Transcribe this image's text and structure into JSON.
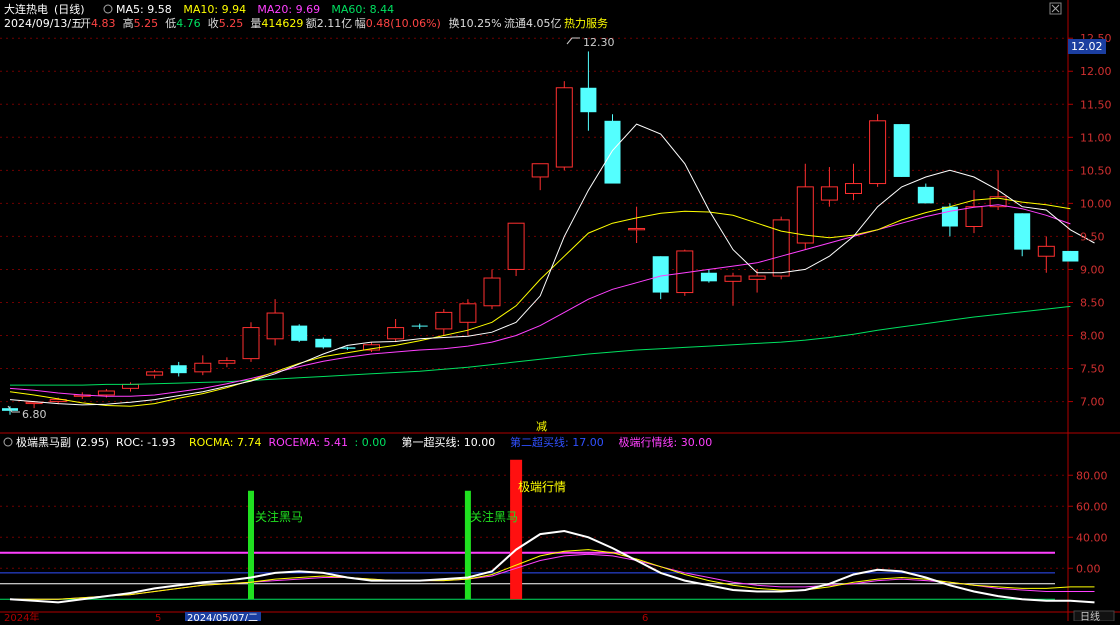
{
  "header": {
    "stock_name": "大连热电",
    "period_label": "(日线)",
    "date": "2024/09/13/五",
    "items": [
      {
        "label": "开",
        "value": "4.83",
        "color": "#ff4444"
      },
      {
        "label": "高",
        "value": "5.25",
        "color": "#ff4444"
      },
      {
        "label": "低",
        "value": "4.76",
        "color": "#00e060"
      },
      {
        "label": "收",
        "value": "5.25",
        "color": "#ff4444"
      },
      {
        "label": "量",
        "value": "414629",
        "color": "#ffff00"
      },
      {
        "label": "额",
        "value": "2.11亿",
        "color": "#dddddd"
      },
      {
        "label": "幅",
        "value": "0.48(10.06%)",
        "color": "#ff4444"
      },
      {
        "label": "换",
        "value": "10.25%",
        "color": "#dddddd"
      },
      {
        "label": "流通",
        "value": "4.05亿",
        "color": "#dddddd"
      },
      {
        "label": "",
        "value": "热力服务",
        "color": "#ffff00"
      }
    ],
    "ma_legend": [
      {
        "label": "MA5: 9.58",
        "color": "#ffffff"
      },
      {
        "label": "MA10: 9.94",
        "color": "#ffff00"
      },
      {
        "label": "MA20: 9.69",
        "color": "#ff40ff"
      },
      {
        "label": "MA60: 8.44",
        "color": "#00e060"
      }
    ]
  },
  "sub_header": {
    "name": "极端黑马副",
    "param": "(2.95)",
    "items": [
      {
        "label": "ROC: -1.93",
        "color": "#ffffff"
      },
      {
        "label": "ROCMA: 7.74",
        "color": "#ffff00"
      },
      {
        "label": "ROCEMA: 5.41",
        "color": "#ff40ff"
      },
      {
        "label": ": 0.00",
        "color": "#00e060"
      },
      {
        "label": "第一超买线: 10.00",
        "color": "#ffffff"
      },
      {
        "label": "第二超买线: 17.00",
        "color": "#3050ff"
      },
      {
        "label": "极端行情线: 30.00",
        "color": "#ff40ff"
      }
    ]
  },
  "labels": {
    "high_marker": "12.30",
    "low_marker": "6.80",
    "current_price": "12.02",
    "jian": "减",
    "signal_1": "关注黑马",
    "signal_2": "关注黑马",
    "signal_3": "极端行情",
    "date_left": "2024年",
    "date_cursor": "2024/05/07/二",
    "month_5": "5",
    "month_6": "6",
    "period_button": "日线"
  },
  "colors": {
    "up": "#ff3030",
    "down": "#54ffff",
    "ma5": "#ffffff",
    "ma10": "#ffff00",
    "ma20": "#ff40ff",
    "ma60": "#00e060",
    "axis": "#b00000",
    "green_bar": "#20e020",
    "red_bar": "#ff1010"
  },
  "chart_data": [
    {
      "type": "candlestick",
      "title": "大连热电(日线)",
      "ylim": [
        6.6,
        12.7
      ],
      "yticks": [
        7.0,
        7.5,
        8.0,
        8.5,
        9.0,
        9.5,
        10.0,
        10.5,
        11.0,
        11.5,
        12.0,
        12.5
      ],
      "candles": [
        {
          "o": 6.9,
          "h": 6.93,
          "l": 6.8,
          "c": 6.86
        },
        {
          "o": 6.97,
          "h": 7.01,
          "l": 6.9,
          "c": 6.99
        },
        {
          "o": 7.0,
          "h": 7.06,
          "l": 6.96,
          "c": 7.03
        },
        {
          "o": 7.08,
          "h": 7.14,
          "l": 7.04,
          "c": 7.1
        },
        {
          "o": 7.1,
          "h": 7.19,
          "l": 7.06,
          "c": 7.16
        },
        {
          "o": 7.2,
          "h": 7.29,
          "l": 7.15,
          "c": 7.26
        },
        {
          "o": 7.4,
          "h": 7.48,
          "l": 7.35,
          "c": 7.45
        },
        {
          "o": 7.55,
          "h": 7.6,
          "l": 7.38,
          "c": 7.43
        },
        {
          "o": 7.45,
          "h": 7.7,
          "l": 7.4,
          "c": 7.58
        },
        {
          "o": 7.58,
          "h": 7.67,
          "l": 7.52,
          "c": 7.62
        },
        {
          "o": 7.65,
          "h": 8.2,
          "l": 7.6,
          "c": 8.12
        },
        {
          "o": 7.95,
          "h": 8.55,
          "l": 7.85,
          "c": 8.34
        },
        {
          "o": 8.15,
          "h": 8.17,
          "l": 7.9,
          "c": 7.92
        },
        {
          "o": 7.95,
          "h": 7.97,
          "l": 7.8,
          "c": 7.82
        },
        {
          "o": 7.82,
          "h": 7.83,
          "l": 7.78,
          "c": 7.8
        },
        {
          "o": 7.78,
          "h": 7.9,
          "l": 7.75,
          "c": 7.86
        },
        {
          "o": 7.95,
          "h": 8.25,
          "l": 7.9,
          "c": 8.12
        },
        {
          "o": 8.15,
          "h": 8.18,
          "l": 8.1,
          "c": 8.14
        },
        {
          "o": 8.1,
          "h": 8.4,
          "l": 8.0,
          "c": 8.35
        },
        {
          "o": 8.2,
          "h": 8.55,
          "l": 8.0,
          "c": 8.48
        },
        {
          "o": 8.45,
          "h": 9.0,
          "l": 8.4,
          "c": 8.87
        },
        {
          "o": 9.0,
          "h": 9.7,
          "l": 8.9,
          "c": 9.7
        },
        {
          "o": 10.4,
          "h": 10.55,
          "l": 10.2,
          "c": 10.6
        },
        {
          "o": 10.55,
          "h": 11.85,
          "l": 10.5,
          "c": 11.75
        },
        {
          "o": 11.75,
          "h": 12.3,
          "l": 11.1,
          "c": 11.38
        },
        {
          "o": 11.25,
          "h": 11.35,
          "l": 10.3,
          "c": 10.3
        },
        {
          "o": 9.6,
          "h": 9.95,
          "l": 9.4,
          "c": 9.62
        },
        {
          "o": 9.2,
          "h": 9.2,
          "l": 8.55,
          "c": 8.65
        },
        {
          "o": 8.65,
          "h": 9.3,
          "l": 8.6,
          "c": 9.28
        },
        {
          "o": 8.95,
          "h": 9.0,
          "l": 8.8,
          "c": 8.82
        },
        {
          "o": 8.82,
          "h": 8.95,
          "l": 8.45,
          "c": 8.9
        },
        {
          "o": 8.85,
          "h": 9.0,
          "l": 8.65,
          "c": 8.9
        },
        {
          "o": 8.9,
          "h": 9.8,
          "l": 8.85,
          "c": 9.75
        },
        {
          "o": 9.4,
          "h": 10.6,
          "l": 9.3,
          "c": 10.25
        },
        {
          "o": 10.05,
          "h": 10.55,
          "l": 9.95,
          "c": 10.25
        },
        {
          "o": 10.15,
          "h": 10.6,
          "l": 10.05,
          "c": 10.3
        },
        {
          "o": 10.3,
          "h": 11.35,
          "l": 10.25,
          "c": 11.25
        },
        {
          "o": 11.2,
          "h": 11.2,
          "l": 10.4,
          "c": 10.4
        },
        {
          "o": 10.25,
          "h": 10.3,
          "l": 10.0,
          "c": 10.0
        },
        {
          "o": 9.95,
          "h": 10.0,
          "l": 9.5,
          "c": 9.65
        },
        {
          "o": 9.65,
          "h": 10.2,
          "l": 9.55,
          "c": 9.95
        },
        {
          "o": 9.95,
          "h": 10.5,
          "l": 9.9,
          "c": 10.1
        },
        {
          "o": 9.85,
          "h": 9.85,
          "l": 9.2,
          "c": 9.3
        },
        {
          "o": 9.2,
          "h": 9.5,
          "l": 8.95,
          "c": 9.35
        },
        {
          "o": 9.28,
          "h": 9.28,
          "l": 9.12,
          "c": 9.12
        }
      ],
      "ma5": [
        7.03,
        7.0,
        6.97,
        6.95,
        6.96,
        6.99,
        7.03,
        7.09,
        7.15,
        7.23,
        7.31,
        7.42,
        7.57,
        7.72,
        7.85,
        7.9,
        7.91,
        7.95,
        7.97,
        7.99,
        8.05,
        8.2,
        8.6,
        9.5,
        10.2,
        10.8,
        11.2,
        11.05,
        10.6,
        9.9,
        9.3,
        8.95,
        8.95,
        9.0,
        9.2,
        9.5,
        9.95,
        10.25,
        10.4,
        10.5,
        10.4,
        10.2,
        9.95,
        9.9,
        9.6,
        9.4
      ],
      "ma10": [
        7.15,
        7.1,
        7.04,
        6.98,
        6.94,
        6.93,
        6.97,
        7.05,
        7.12,
        7.21,
        7.32,
        7.45,
        7.58,
        7.68,
        7.74,
        7.8,
        7.85,
        7.92,
        8.0,
        8.08,
        8.2,
        8.45,
        8.85,
        9.2,
        9.55,
        9.7,
        9.78,
        9.85,
        9.88,
        9.87,
        9.82,
        9.7,
        9.58,
        9.52,
        9.48,
        9.52,
        9.6,
        9.75,
        9.86,
        9.95,
        10.05,
        10.08,
        10.02,
        9.98,
        9.92
      ],
      "ma20": [
        7.2,
        7.17,
        7.13,
        7.1,
        7.08,
        7.08,
        7.1,
        7.15,
        7.2,
        7.27,
        7.35,
        7.44,
        7.53,
        7.61,
        7.67,
        7.72,
        7.75,
        7.78,
        7.8,
        7.84,
        7.9,
        8.0,
        8.15,
        8.35,
        8.55,
        8.7,
        8.8,
        8.9,
        8.95,
        9.0,
        9.05,
        9.1,
        9.2,
        9.3,
        9.4,
        9.5,
        9.6,
        9.7,
        9.8,
        9.88,
        9.94,
        9.98,
        9.92,
        9.82,
        9.69
      ],
      "ma60": [
        7.25,
        7.25,
        7.25,
        7.25,
        7.26,
        7.26,
        7.27,
        7.28,
        7.29,
        7.3,
        7.32,
        7.34,
        7.36,
        7.38,
        7.4,
        7.42,
        7.44,
        7.46,
        7.49,
        7.52,
        7.56,
        7.6,
        7.64,
        7.68,
        7.72,
        7.75,
        7.78,
        7.8,
        7.82,
        7.84,
        7.86,
        7.88,
        7.9,
        7.93,
        7.97,
        8.02,
        8.08,
        8.13,
        8.18,
        8.23,
        8.28,
        8.32,
        8.36,
        8.4,
        8.44
      ]
    },
    {
      "type": "line",
      "title": "极端黑马副(2.95)",
      "ylim": [
        -5,
        95
      ],
      "yticks": [
        20.0,
        40.0,
        60.0,
        80.0
      ],
      "ytick_labels": [
        "0.00",
        "40.00",
        "60.00",
        "80.00"
      ],
      "levels": [
        {
          "name": "第一超买线",
          "value": 10,
          "color": "#ffffff"
        },
        {
          "name": "第二超买线",
          "value": 17,
          "color": "#3050ff"
        },
        {
          "name": "极端行情线",
          "value": 30,
          "color": "#ff40ff"
        },
        {
          "name": "",
          "value": 0,
          "color": "#00e060"
        }
      ],
      "roc": [
        0,
        -1,
        -2,
        0,
        2,
        4,
        7,
        9,
        11,
        12,
        14,
        17,
        18,
        17,
        14,
        12,
        12,
        12,
        13,
        14,
        18,
        32,
        42,
        44,
        40,
        33,
        25,
        17,
        12,
        9,
        6,
        5,
        5,
        6,
        10,
        16,
        19,
        18,
        14,
        9,
        5,
        2,
        0,
        -1,
        -1,
        -2
      ],
      "rocma": [
        0,
        0,
        0,
        1,
        2,
        3,
        5,
        7,
        9,
        10,
        11,
        13,
        14,
        15,
        14,
        13,
        12,
        12,
        12,
        13,
        16,
        22,
        28,
        31,
        32,
        30,
        26,
        21,
        16,
        12,
        9,
        7,
        6,
        6,
        8,
        11,
        13,
        14,
        13,
        11,
        9,
        8,
        7,
        7,
        8,
        8
      ],
      "rocema": [
        0,
        0,
        0,
        1,
        2,
        3,
        5,
        7,
        9,
        10,
        11,
        12,
        13,
        14,
        14,
        13,
        12,
        12,
        12,
        13,
        15,
        20,
        25,
        28,
        29,
        28,
        25,
        21,
        17,
        14,
        11,
        9,
        8,
        8,
        9,
        10,
        12,
        13,
        12,
        11,
        9,
        7,
        6,
        5,
        5,
        5
      ],
      "signal_bars": [
        {
          "index": 10,
          "value": 70,
          "color": "#20e020",
          "label": "关注黑马"
        },
        {
          "index": 19,
          "value": 70,
          "color": "#20e020",
          "label": "关注黑马"
        },
        {
          "index": 21,
          "value": 90,
          "color": "#ff1010",
          "label": "极端行情"
        }
      ]
    }
  ]
}
